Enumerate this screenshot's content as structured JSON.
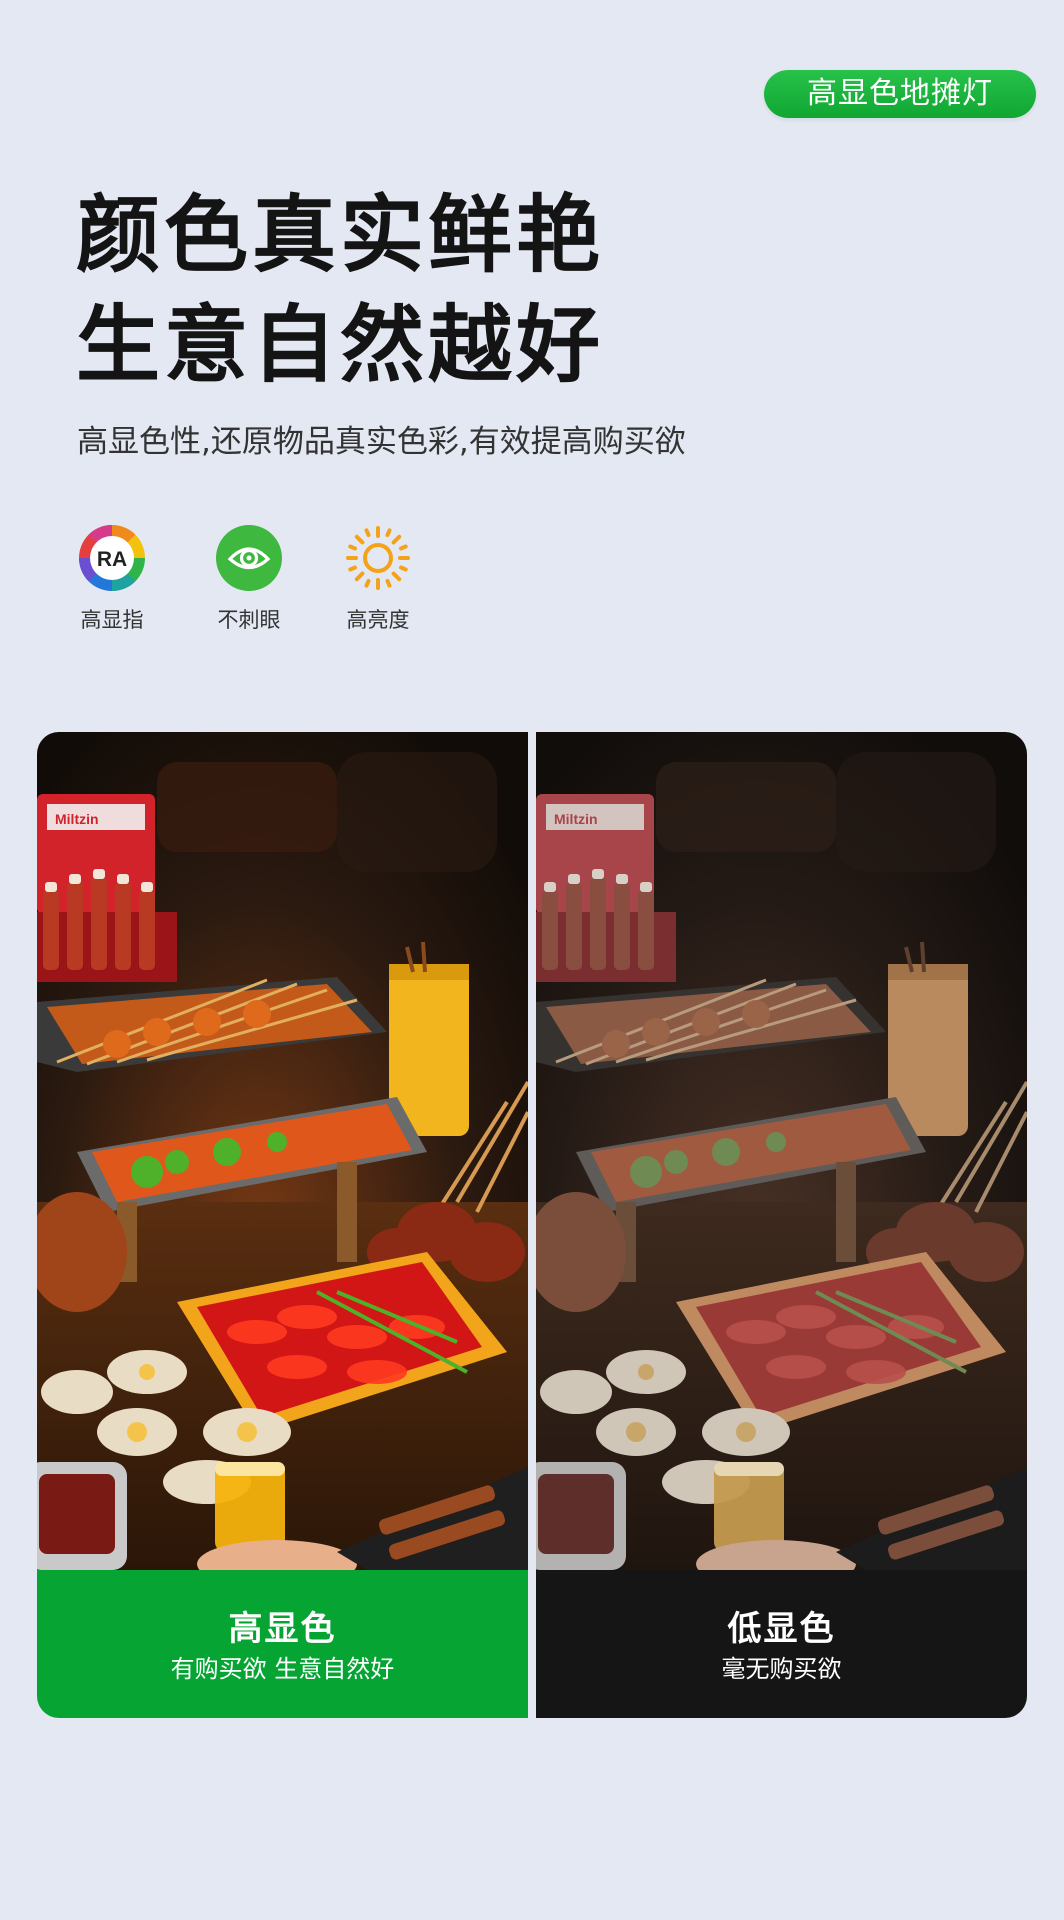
{
  "tag": "高显色地摊灯",
  "headline": [
    "颜色真实鲜艳",
    "生意自然越好"
  ],
  "subheadline": "高显色性,还原物品真实色彩,有效提高购买欲",
  "features": [
    {
      "icon": "ra-color-wheel-icon",
      "label": "高显指",
      "badge": "RA"
    },
    {
      "icon": "eye-icon",
      "label": "不刺眼"
    },
    {
      "icon": "sun-icon",
      "label": "高亮度"
    }
  ],
  "comparison": {
    "left": {
      "title": "高显色",
      "subtitle": "有购买欲 生意自然好",
      "photo_text": "Miltzin",
      "color": "#06a533"
    },
    "right": {
      "title": "低显色",
      "subtitle": "毫无购买欲",
      "photo_text": "Miltzin",
      "color": "#151515"
    }
  },
  "colors": {
    "accent": "#06a533",
    "background": "#e3e8f2",
    "headline": "#141414"
  }
}
